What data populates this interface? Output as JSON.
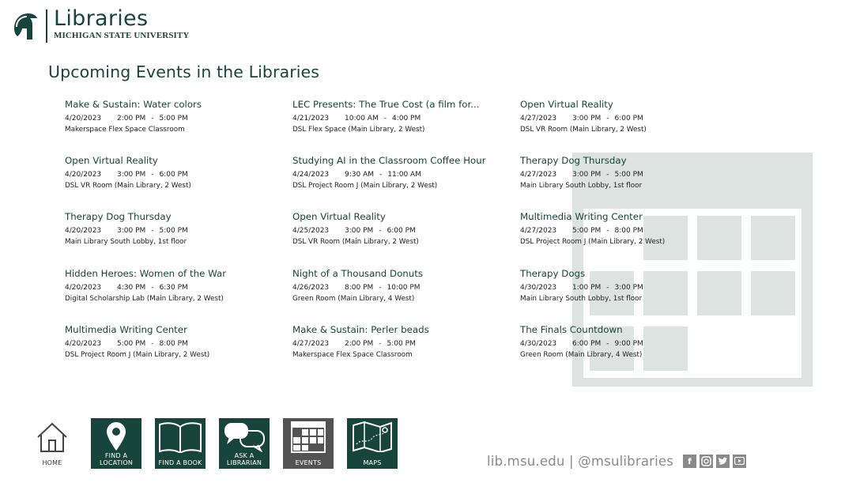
{
  "header": {
    "logo_title": "Libraries",
    "logo_subtitle": "MICHIGAN STATE UNIVERSITY"
  },
  "page_title": "Upcoming Events in the Libraries",
  "events": [
    {
      "title": "Make & Sustain: Water colors",
      "date": "4/20/2023",
      "start": "2:00 PM",
      "end": "5:00 PM",
      "location": "Makerspace Flex Space Classroom"
    },
    {
      "title": "Open Virtual Reality",
      "date": "4/20/2023",
      "start": "3:00 PM",
      "end": "6:00 PM",
      "location": "DSL VR Room (Main Library, 2 West)"
    },
    {
      "title": "Therapy Dog Thursday",
      "date": "4/20/2023",
      "start": "3:00 PM",
      "end": "5:00 PM",
      "location": "Main Library South Lobby, 1st floor"
    },
    {
      "title": "Hidden Heroes: Women of the War",
      "date": "4/20/2023",
      "start": "4:30 PM",
      "end": "6:30 PM",
      "location": "Digital Scholarship Lab (Main Library, 2 West)"
    },
    {
      "title": "Multimedia Writing Center",
      "date": "4/20/2023",
      "start": "5:00 PM",
      "end": "8:00 PM",
      "location": "DSL Project Room J (Main Library, 2 West)"
    },
    {
      "title": "LEC Presents: The True Cost (a film for...",
      "date": "4/21/2023",
      "start": "10:00 AM",
      "end": "4:00 PM",
      "location": "DSL Flex Space (Main Library, 2 West)"
    },
    {
      "title": "Studying AI in the Classroom Coffee Hour",
      "date": "4/24/2023",
      "start": "9:30 AM",
      "end": "11:00 AM",
      "location": "DSL Project Room J (Main Library, 2 West)"
    },
    {
      "title": "Open Virtual Reality",
      "date": "4/25/2023",
      "start": "3:00 PM",
      "end": "6:00 PM",
      "location": "DSL VR Room (Main Library, 2 West)"
    },
    {
      "title": "Night of a Thousand Donuts",
      "date": "4/26/2023",
      "start": "8:00 PM",
      "end": "10:00 PM",
      "location": "Green Room (Main Library, 4 West)"
    },
    {
      "title": "Make & Sustain: Perler beads",
      "date": "4/27/2023",
      "start": "2:00 PM",
      "end": "5:00 PM",
      "location": "Makerspace Flex Space Classroom"
    },
    {
      "title": "Open Virtual Reality",
      "date": "4/27/2023",
      "start": "3:00 PM",
      "end": "6:00 PM",
      "location": "DSL VR Room (Main Library, 2 West)"
    },
    {
      "title": "Therapy Dog Thursday",
      "date": "4/27/2023",
      "start": "3:00 PM",
      "end": "5:00 PM",
      "location": "Main Library South Lobby, 1st floor"
    },
    {
      "title": "Multimedia Writing Center",
      "date": "4/27/2023",
      "start": "5:00 PM",
      "end": "8:00 PM",
      "location": "DSL Project Room J (Main Library, 2 West)"
    },
    {
      "title": "Therapy Dogs",
      "date": "4/30/2023",
      "start": "1:00 PM",
      "end": "3:00 PM",
      "location": "Main Library South Lobby, 1st floor"
    },
    {
      "title": "The Finals Countdown",
      "date": "4/30/2023",
      "start": "6:00 PM",
      "end": "9:00 PM",
      "location": "Green Room (Main Library, 4 West)"
    }
  ],
  "time_separator": "-",
  "nav": [
    {
      "label": "HOME",
      "icon": "home-icon"
    },
    {
      "label": "FIND A LOCATION",
      "icon": "map-pin-icon"
    },
    {
      "label": "FIND A BOOK",
      "icon": "open-book-icon"
    },
    {
      "label": "ASK A LIBRARIAN",
      "icon": "chat-bubbles-icon"
    },
    {
      "label": "EVENTS",
      "icon": "calendar-icon"
    },
    {
      "label": "MAPS",
      "icon": "folded-map-icon"
    }
  ],
  "footer": {
    "text": "lib.msu.edu | @msulibraries",
    "social": [
      {
        "icon": "facebook-icon",
        "glyph": "f"
      },
      {
        "icon": "instagram-icon",
        "glyph": ""
      },
      {
        "icon": "twitter-icon",
        "glyph": ""
      },
      {
        "icon": "youtube-icon",
        "glyph": ""
      }
    ]
  },
  "colors": {
    "brand_green": "#18453b",
    "active_nav": "#535353",
    "watermark": "#dde3e0",
    "footer_gray": "#8a8a8a"
  }
}
